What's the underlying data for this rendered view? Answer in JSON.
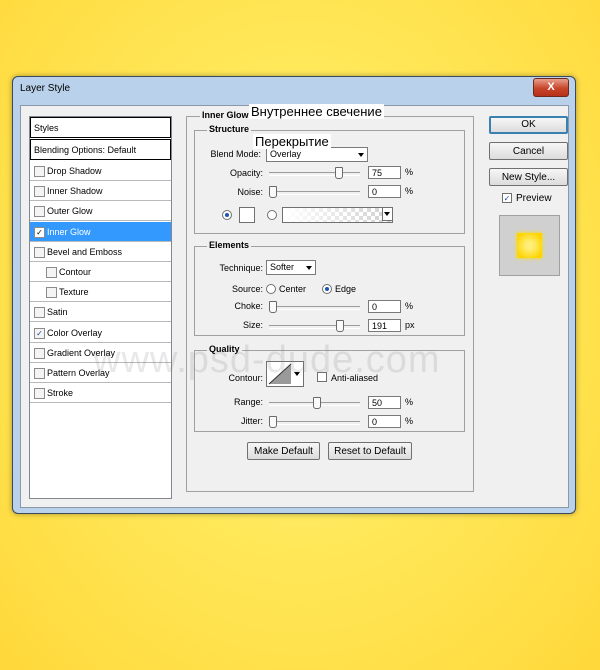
{
  "window": {
    "title": "Layer Style",
    "close_label": "X"
  },
  "styles_list": {
    "items": [
      {
        "label": "Styles",
        "header": true
      },
      {
        "label": "Blending Options: Default",
        "header": true
      },
      {
        "label": "Drop Shadow",
        "checked": false
      },
      {
        "label": "Inner Shadow",
        "checked": false
      },
      {
        "label": "Outer Glow",
        "checked": false
      },
      {
        "label": "Inner Glow",
        "checked": true,
        "selected": true
      },
      {
        "label": "Bevel and Emboss",
        "checked": false
      },
      {
        "label": "Contour",
        "checked": false,
        "indent": true
      },
      {
        "label": "Texture",
        "checked": false,
        "indent": true
      },
      {
        "label": "Satin",
        "checked": false
      },
      {
        "label": "Color Overlay",
        "checked": true
      },
      {
        "label": "Gradient Overlay",
        "checked": false
      },
      {
        "label": "Pattern Overlay",
        "checked": false
      },
      {
        "label": "Stroke",
        "checked": false
      }
    ]
  },
  "panel": {
    "title": "Inner Glow"
  },
  "structure": {
    "title": "Structure",
    "blend_mode_label": "Blend Mode:",
    "blend_mode_value": "Overlay",
    "opacity_label": "Opacity:",
    "opacity_value": "75",
    "opacity_unit": "%",
    "opacity_level": 0.75,
    "noise_label": "Noise:",
    "noise_value": "0",
    "noise_unit": "%",
    "noise_level": 0
  },
  "elements": {
    "title": "Elements",
    "technique_label": "Technique:",
    "technique_value": "Softer",
    "source_label": "Source:",
    "source_center": "Center",
    "source_edge": "Edge",
    "choke_label": "Choke:",
    "choke_value": "0",
    "choke_unit": "%",
    "choke_level": 0,
    "size_label": "Size:",
    "size_value": "191",
    "size_unit": "px",
    "size_level": 0.76
  },
  "quality": {
    "title": "Quality",
    "contour_label": "Contour:",
    "antialiased_label": "Anti-aliased",
    "range_label": "Range:",
    "range_value": "50",
    "range_unit": "%",
    "range_level": 0.5,
    "jitter_label": "Jitter:",
    "jitter_value": "0",
    "jitter_unit": "%",
    "jitter_level": 0
  },
  "buttons": {
    "make_default": "Make Default",
    "reset_default": "Reset to Default",
    "ok": "OK",
    "cancel": "Cancel",
    "new_style": "New Style...",
    "preview": "Preview"
  },
  "annotations": {
    "inner_glow_ru": "Внутреннее свечение",
    "overlay_ru": "Перекрытие"
  },
  "watermark": "www.psd-dude.com",
  "colors": {
    "background": "#ffe24a",
    "selected": "#3399ff",
    "preview_glow": "#ffd400"
  }
}
